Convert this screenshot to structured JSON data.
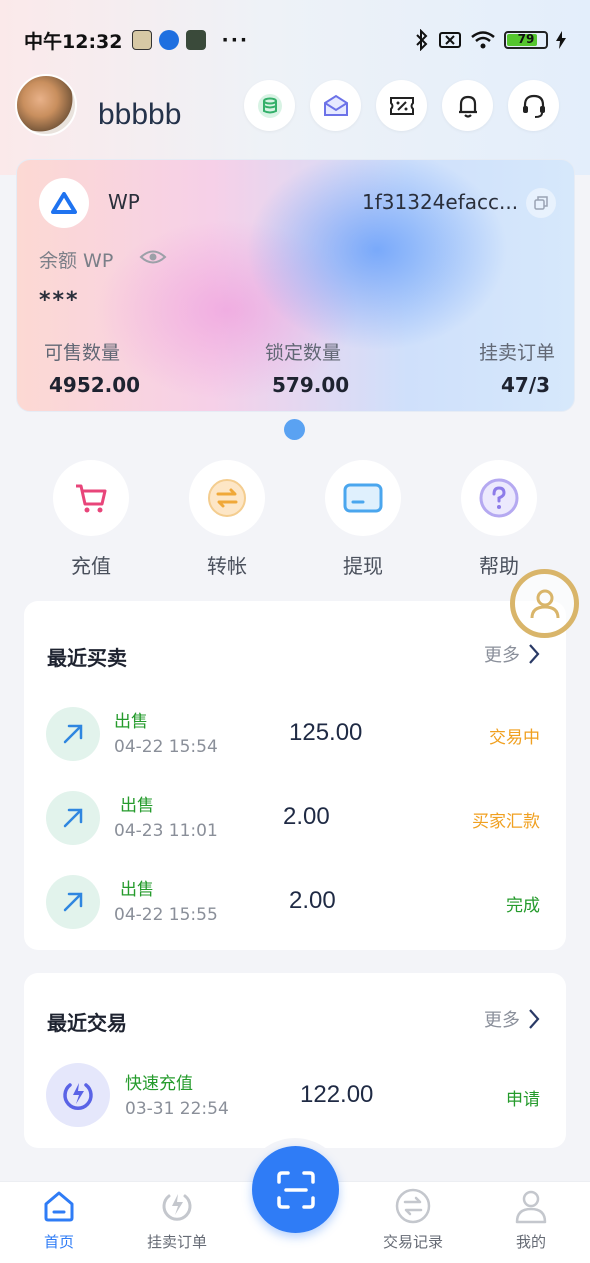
{
  "status_bar": {
    "time": "中午12:32",
    "dots": "···",
    "battery": "79"
  },
  "header": {
    "username": "bbbbb"
  },
  "wallet": {
    "coin_name": "WP",
    "address": "1f31324efacc...",
    "balance_label": "余额 WP",
    "balance_value": "***",
    "stats": [
      {
        "label": "可售数量",
        "value": "4952.00"
      },
      {
        "label": "锁定数量",
        "value": "579.00"
      },
      {
        "label": "挂卖订单",
        "value": "47/3"
      }
    ]
  },
  "actions": [
    {
      "label": "充值",
      "icon": "cart-icon"
    },
    {
      "label": "转帐",
      "icon": "transfer-icon"
    },
    {
      "label": "提现",
      "icon": "card-icon"
    },
    {
      "label": "帮助",
      "icon": "help-icon"
    }
  ],
  "recent_trades": {
    "title": "最近买卖",
    "more": "更多",
    "rows": [
      {
        "type": "出售",
        "time": "04-22 15:54",
        "amount": "125.00",
        "status": "交易中",
        "status_color": "#f0a020"
      },
      {
        "type": "出售",
        "time": "04-23 11:01",
        "amount": "2.00",
        "status": "买家汇款",
        "status_color": "#f0a020"
      },
      {
        "type": "出售",
        "time": "04-22 15:55",
        "amount": "2.00",
        "status": "完成",
        "status_color": "#259b2c"
      }
    ]
  },
  "recent_transactions": {
    "title": "最近交易",
    "more": "更多",
    "rows": [
      {
        "type": "快速充值",
        "time": "03-31 22:54",
        "amount": "122.00",
        "status": "申请",
        "status_color": "#259b2c"
      }
    ]
  },
  "tab_bar": {
    "tabs": [
      {
        "label": "首页",
        "active": true
      },
      {
        "label": "挂卖订单",
        "active": false
      },
      {
        "label": "交易记录",
        "active": false
      },
      {
        "label": "我的",
        "active": false
      }
    ]
  },
  "colors": {
    "accent": "#2f7cf6",
    "sell_green": "#259b2c",
    "pending_orange": "#f0a020"
  }
}
